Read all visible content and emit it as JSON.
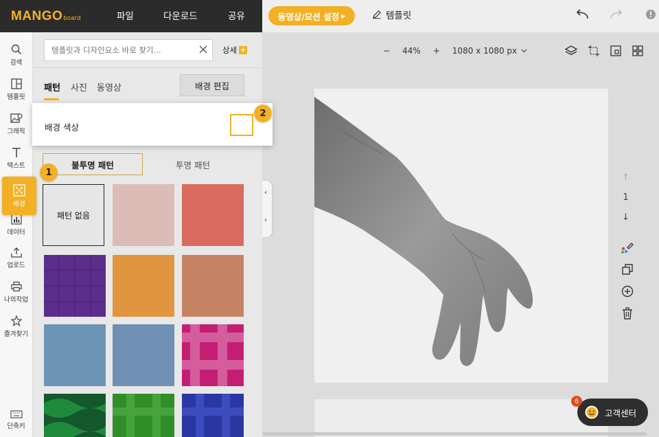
{
  "app": {
    "logo": "MANGO",
    "logo_sub": "board"
  },
  "topmenu": {
    "file": "파일",
    "download": "다운로드",
    "share": "공유",
    "motion_settings": "동영상/모션 설정",
    "template": "템플릿"
  },
  "sidebar": {
    "items": [
      {
        "label": "검색",
        "icon": "search-icon"
      },
      {
        "label": "템플릿",
        "icon": "template-icon"
      },
      {
        "label": "그래픽",
        "icon": "graphic-icon"
      },
      {
        "label": "텍스트",
        "icon": "text-icon"
      },
      {
        "label": "배경",
        "icon": "background-icon"
      },
      {
        "label": "데이터",
        "icon": "chart-icon"
      },
      {
        "label": "업로드",
        "icon": "upload-icon"
      },
      {
        "label": "나의작업",
        "icon": "printer-icon"
      },
      {
        "label": "즐겨찾기",
        "icon": "star-icon"
      }
    ],
    "shortcut": "단축키"
  },
  "panel": {
    "search_placeholder": "템플릿과 디자인요소 바로 찾기...",
    "detail": "상세",
    "tabs": [
      "패턴",
      "사진",
      "동영상"
    ],
    "bg_edit": "배경 편집",
    "bg_color_label": "배경 색상",
    "segment": [
      "불투명 패턴",
      "투명 패턴"
    ],
    "no_pattern": "패턴 없음",
    "tile_colors": [
      "#dcbcb4",
      "#d96a5e",
      "#5b2d8c",
      "#e1953e",
      "#c58363",
      "#6c94b5",
      "#6f8fb4",
      "#c41e74",
      "#14582c",
      "#2f8d2a",
      "#2a37a2"
    ]
  },
  "canvas": {
    "zoom": "44%",
    "size": "1080 x 1080 px",
    "page": "1"
  },
  "support": {
    "label": "고객센터",
    "badge": "6"
  },
  "callouts": [
    "1",
    "2"
  ]
}
